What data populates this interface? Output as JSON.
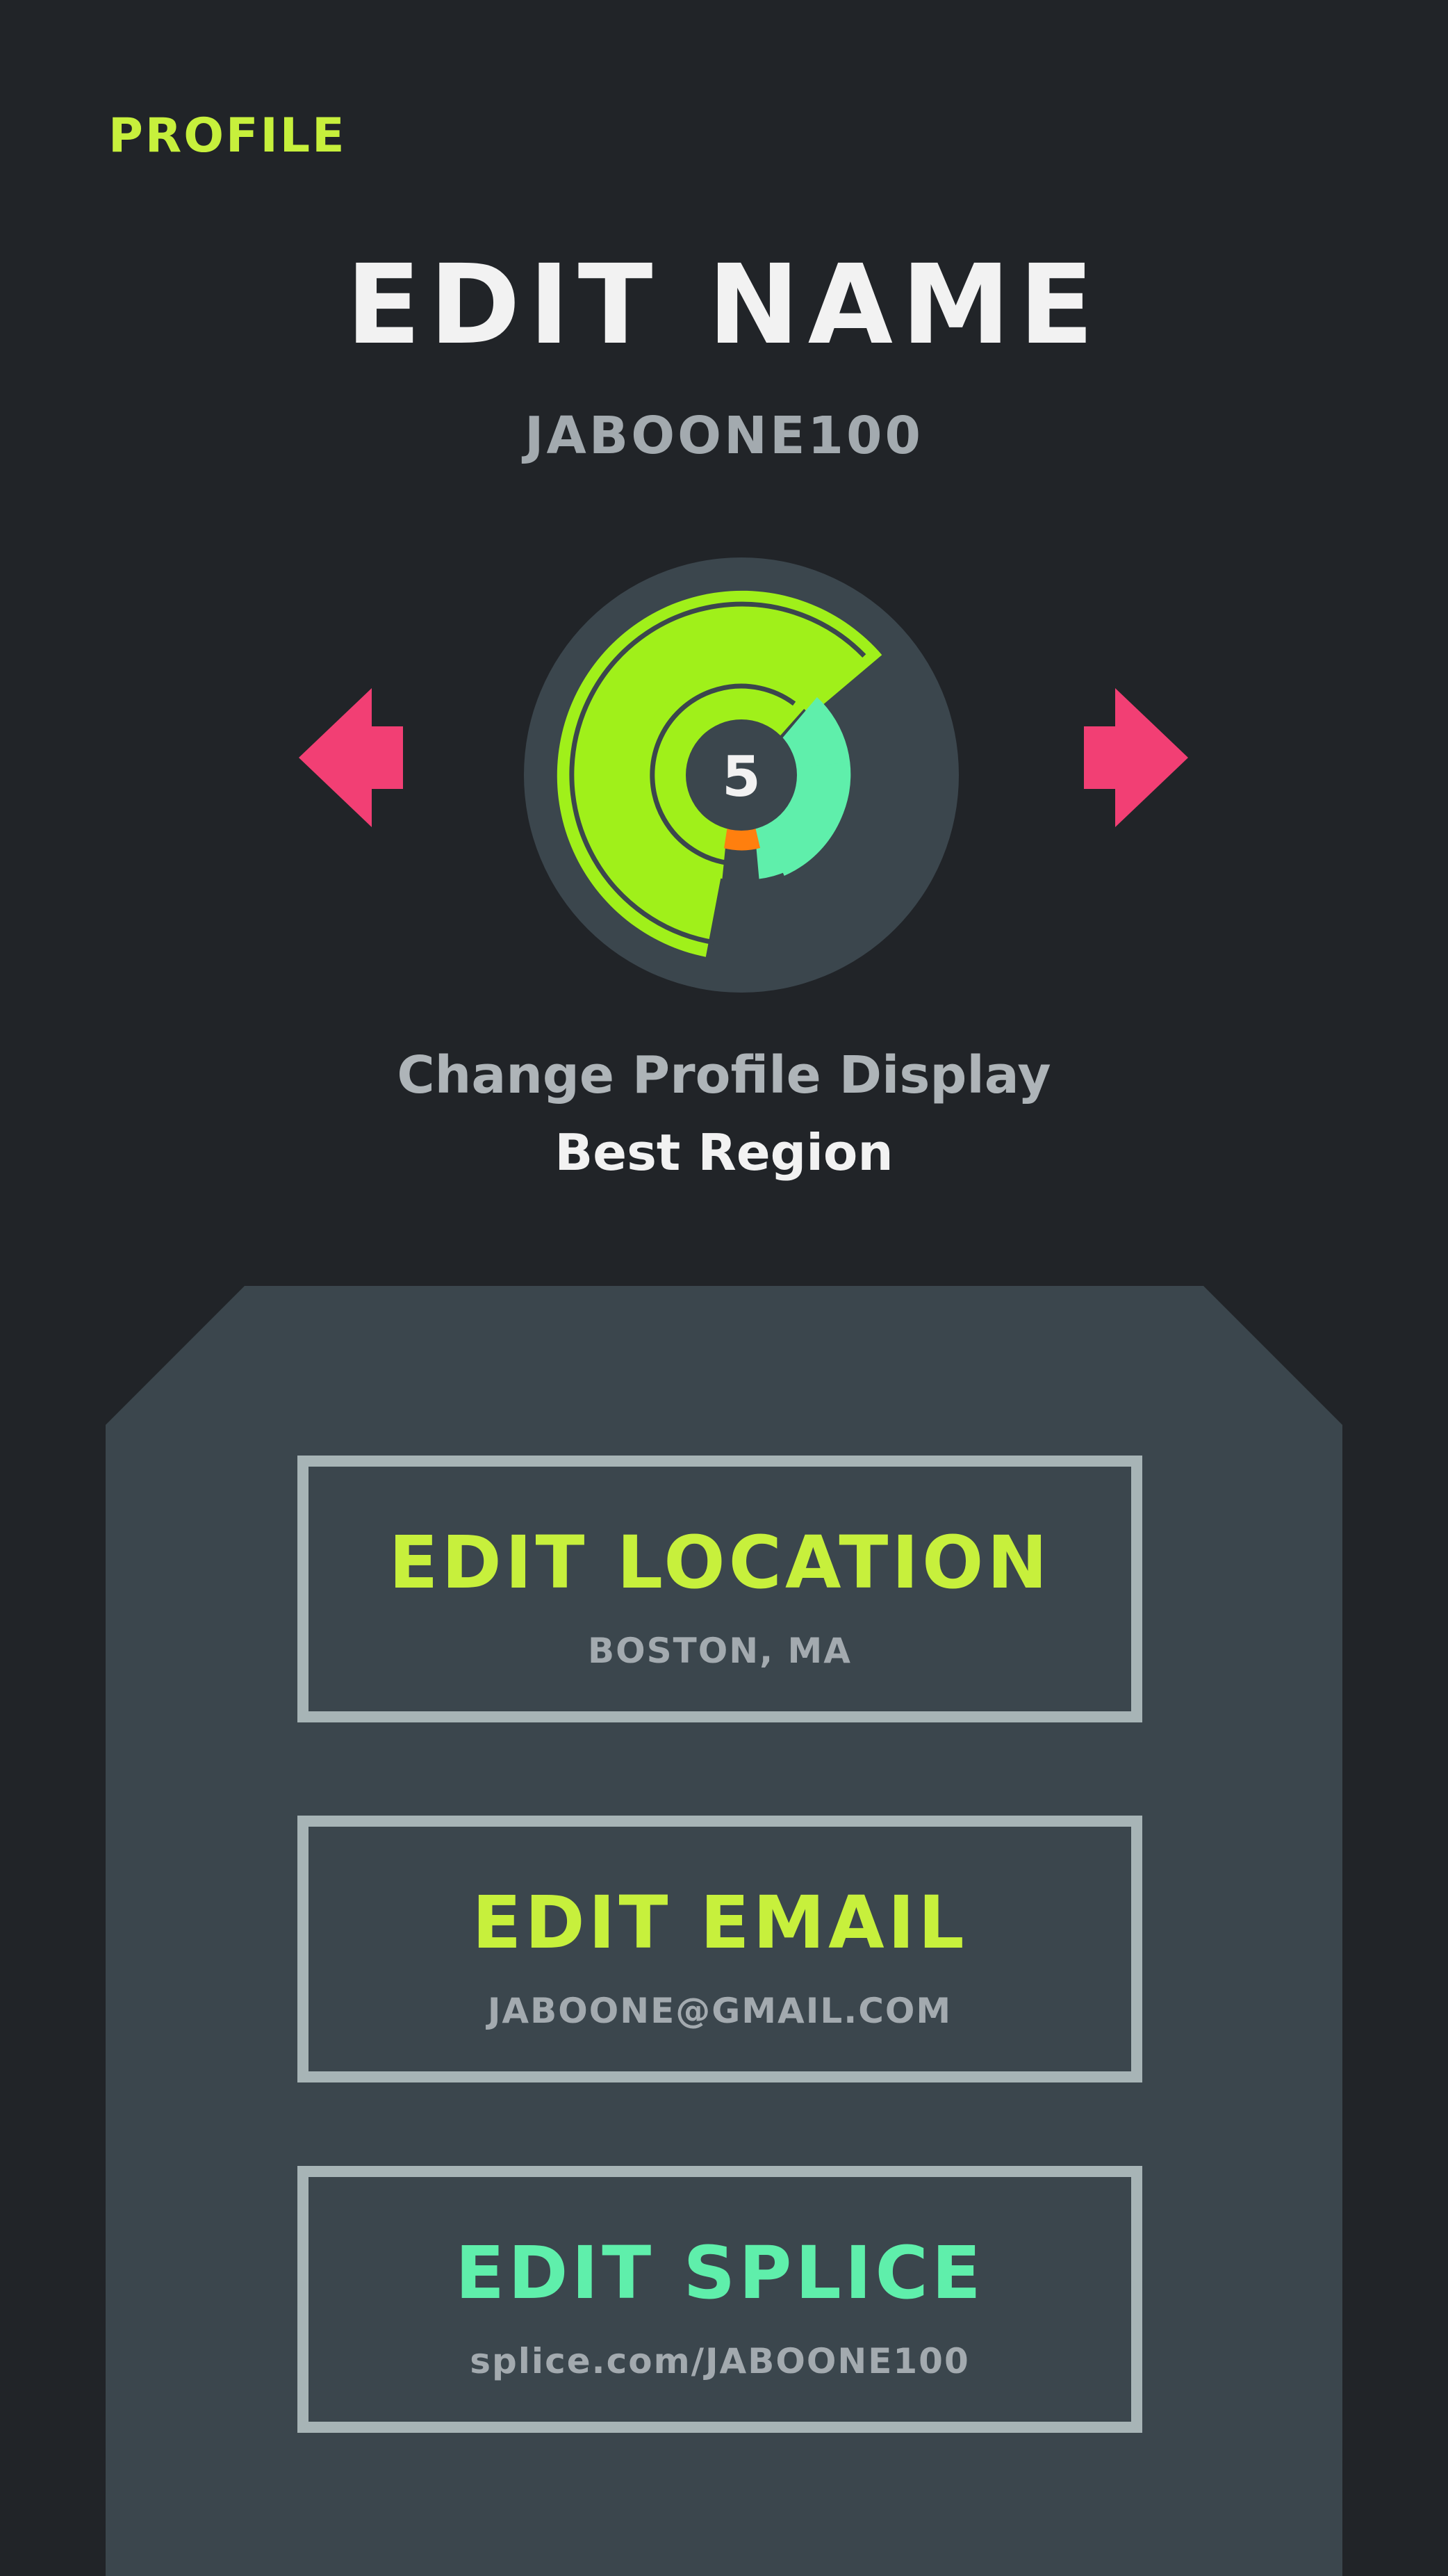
{
  "header": {
    "nav_label": "PROFILE",
    "title": "EDIT NAME",
    "username": "JABOONE100"
  },
  "profile_display": {
    "badge_value": "5",
    "change_label": "Change Profile Display",
    "current_display": "Best Region",
    "icons": {
      "previous": "arrow-left-icon",
      "next": "arrow-right-icon"
    }
  },
  "fields": {
    "location": {
      "title": "EDIT LOCATION",
      "value": "BOSTON, MA"
    },
    "email": {
      "title": "EDIT EMAIL",
      "value": "JABOONE@GMAIL.COM"
    },
    "splice": {
      "title": "EDIT SPLICE",
      "value": "splice.com/JABOONE100"
    }
  },
  "colors": {
    "background": "#212428",
    "panel": "#3b464d",
    "accent_lime": "#c7f03c",
    "accent_green": "#a0f01a",
    "accent_mint": "#5fefab",
    "accent_orange": "#ff7f0e",
    "arrow_pink": "#f23f74",
    "text_light": "#f2f2f2",
    "text_muted": "#a3aaaf",
    "border": "#a7b4b6"
  }
}
